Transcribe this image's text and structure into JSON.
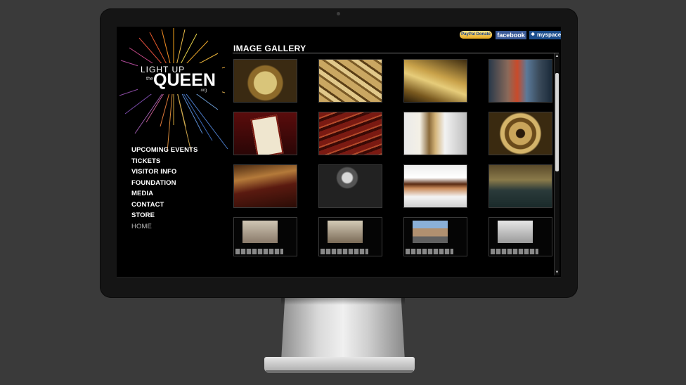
{
  "logo": {
    "line1": "LIGHT UP",
    "line2": "the",
    "line3": "QUEEN",
    "line4": ".org"
  },
  "nav": [
    "UPCOMING EVENTS",
    "TICKETS",
    "VISITOR INFO",
    "FOUNDATION",
    "MEDIA",
    "CONTACT",
    "STORE",
    "HOME"
  ],
  "social": {
    "paypal": "PayPal Donate",
    "facebook": "facebook",
    "myspace": "myspace"
  },
  "gallery": {
    "title": "IMAGE GALLERY",
    "thumbnails": [
      "brass-lamp",
      "paper-tickets",
      "gold-plaque",
      "ruined-lobby",
      "motion-picture-sign",
      "theater-seats",
      "film-strip-closeup",
      "film-reel",
      "balcony-view",
      "projector",
      "film-strip",
      "stage",
      "building-photo-page",
      "street-photo-page",
      "city-street-page",
      "winter-street-page"
    ]
  }
}
